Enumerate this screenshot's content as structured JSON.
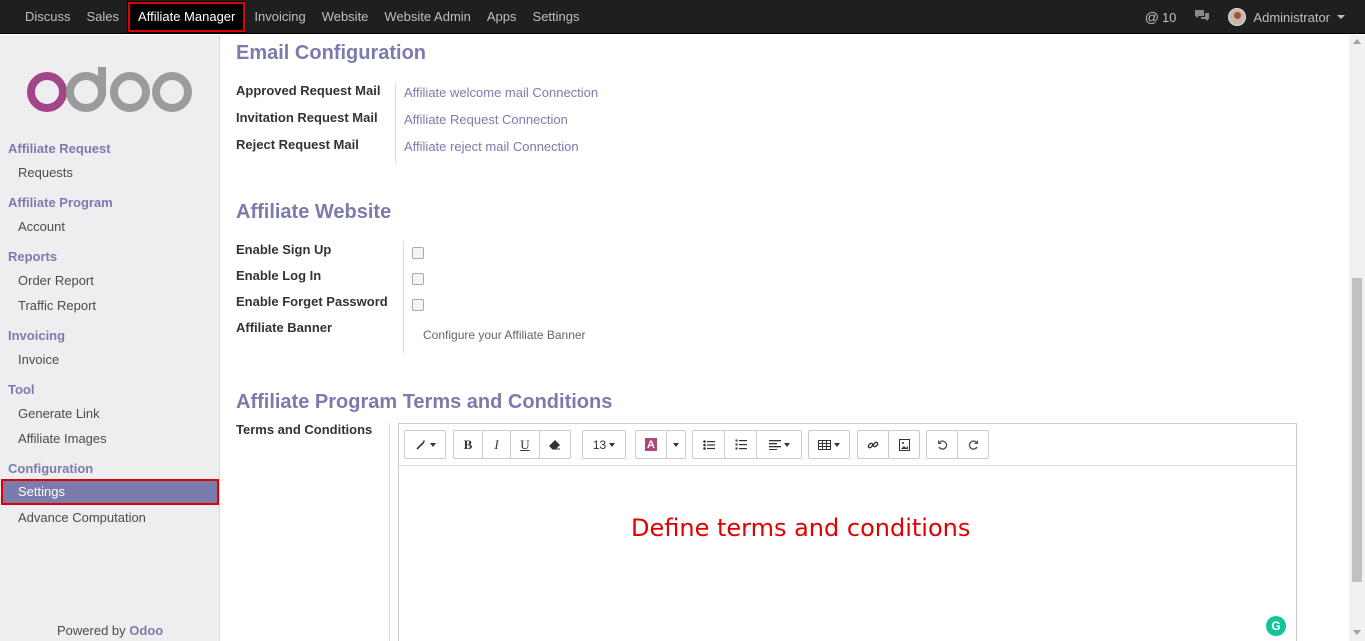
{
  "topbar": {
    "menu": [
      "Discuss",
      "Sales",
      "Affiliate Manager",
      "Invoicing",
      "Website",
      "Website Admin",
      "Apps",
      "Settings"
    ],
    "active": "Affiliate Manager",
    "messages_count": "10",
    "user": "Administrator"
  },
  "sidebar": {
    "logo_text": "odoo",
    "sections": [
      {
        "title": "Affiliate Request",
        "items": [
          "Requests"
        ]
      },
      {
        "title": "Affiliate Program",
        "items": [
          "Account"
        ]
      },
      {
        "title": "Reports",
        "items": [
          "Order Report",
          "Traffic Report"
        ]
      },
      {
        "title": "Invoicing",
        "items": [
          "Invoice"
        ]
      },
      {
        "title": "Tool",
        "items": [
          "Generate Link",
          "Affiliate Images"
        ]
      },
      {
        "title": "Configuration",
        "items": [
          "Settings",
          "Advance Computation"
        ]
      }
    ],
    "selected": "Settings",
    "powered_prefix": "Powered by",
    "powered_brand": "Odoo"
  },
  "email_config": {
    "title": "Email Configuration",
    "rows": [
      {
        "label": "Approved Request Mail",
        "value": "Affiliate welcome mail Connection"
      },
      {
        "label": "Invitation Request Mail",
        "value": "Affiliate Request Connection"
      },
      {
        "label": "Reject Request Mail",
        "value": "Affiliate reject mail Connection"
      }
    ]
  },
  "affiliate_website": {
    "title": "Affiliate Website",
    "rows": [
      {
        "label": "Enable Sign Up",
        "checked": false
      },
      {
        "label": "Enable Log In",
        "checked": false
      },
      {
        "label": "Enable Forget Password",
        "checked": false
      }
    ],
    "banner_label": "Affiliate Banner",
    "banner_link": "Configure your Affiliate Banner"
  },
  "terms": {
    "title": "Affiliate Program Terms and Conditions",
    "label": "Terms and Conditions",
    "font_size": "13",
    "content": "Define terms and conditions"
  },
  "colors": {
    "accent": "#7c7bad",
    "highlight": "#e00000",
    "topbar": "#1f1f1f"
  }
}
